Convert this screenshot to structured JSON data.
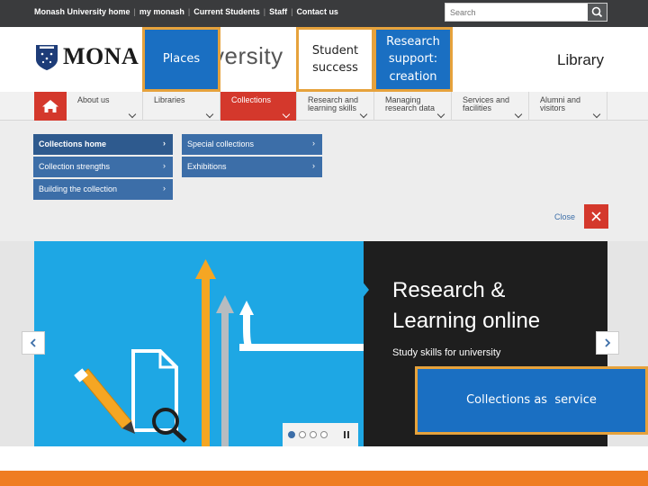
{
  "topbar": {
    "links": [
      "Monash University home",
      "my monash",
      "Current Students",
      "Staff",
      "Contact us"
    ],
    "search_placeholder": "Search"
  },
  "header": {
    "brand_left": "MONA",
    "brand_right": "versity",
    "site_name": "Library"
  },
  "highlights": {
    "places": "Places",
    "student_line1": "Student",
    "student_line2": "success",
    "research_line1": "Research",
    "research_line2": "support:",
    "research_line3": "creation",
    "collections": "Collections as  service"
  },
  "nav": {
    "items": [
      {
        "line1": "About us",
        "line2": ""
      },
      {
        "line1": "Libraries",
        "line2": ""
      },
      {
        "line1": "Collections",
        "line2": ""
      },
      {
        "line1": "Research and",
        "line2": "learning skills"
      },
      {
        "line1": "Managing",
        "line2": "research data"
      },
      {
        "line1": "Services and",
        "line2": "facilities"
      },
      {
        "line1": "Alumni and",
        "line2": "visitors"
      }
    ]
  },
  "dropdown": {
    "col1": [
      "Collections home",
      "Collection strengths",
      "Building the collection"
    ],
    "col2": [
      "Special collections",
      "Exhibitions"
    ],
    "close_label": "Close"
  },
  "carousel": {
    "title_line1": "Research &",
    "title_line2": "Learning online",
    "subtitle": "Study skills for university",
    "active_dot": 1,
    "dot_count": 4
  },
  "colors": {
    "red": "#d4382c",
    "blue": "#3c6ea8",
    "highlight_border": "#e6a23c",
    "orange_strip": "#ef7d22"
  }
}
